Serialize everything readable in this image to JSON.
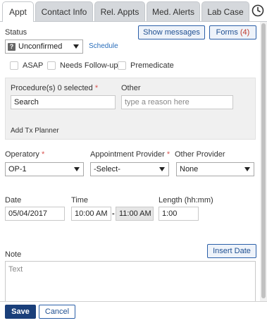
{
  "tabs": [
    {
      "label": "Appt",
      "active": true
    },
    {
      "label": "Contact Info",
      "active": false
    },
    {
      "label": "Rel. Appts",
      "active": false
    },
    {
      "label": "Med. Alerts",
      "active": false
    },
    {
      "label": "Lab Case",
      "active": false
    }
  ],
  "header": {
    "status_label": "Status",
    "show_messages_label": "Show messages",
    "forms_label": "Forms",
    "forms_count": "(4)"
  },
  "status": {
    "icon_glyph": "?",
    "value": "Unconfirmed",
    "schedule_link": "Schedule"
  },
  "flags": {
    "asap": "ASAP",
    "follow_up": "Needs Follow-up",
    "premedicate": "Premedicate"
  },
  "procedures": {
    "label": "Procedure(s) 0 selected",
    "required_mark": "*",
    "search_value": "Search",
    "other_label": "Other",
    "other_placeholder": "type a reason here",
    "add_tx_planner": "Add Tx Planner"
  },
  "operatory": {
    "label": "Operatory",
    "required_mark": "*",
    "value": "OP-1"
  },
  "appt_provider": {
    "label": "Appointment Provider",
    "required_mark": "*",
    "value": "-Select-"
  },
  "other_provider": {
    "label": "Other Provider",
    "value": "None"
  },
  "datetime": {
    "date_label": "Date",
    "date_value": "05/04/2017",
    "time_label": "Time",
    "start_time": "10:00 AM",
    "separator": "-",
    "end_time": "11:00 AM",
    "length_label": "Length (hh:mm)",
    "length_value": "1:00"
  },
  "note": {
    "label": "Note",
    "insert_date_label": "Insert Date",
    "placeholder": "Text"
  },
  "footer": {
    "save_label": "Save",
    "cancel_label": "Cancel"
  },
  "colors": {
    "primary": "#1a3f7a",
    "link": "#2a6ebb",
    "required": "#d9534f"
  }
}
